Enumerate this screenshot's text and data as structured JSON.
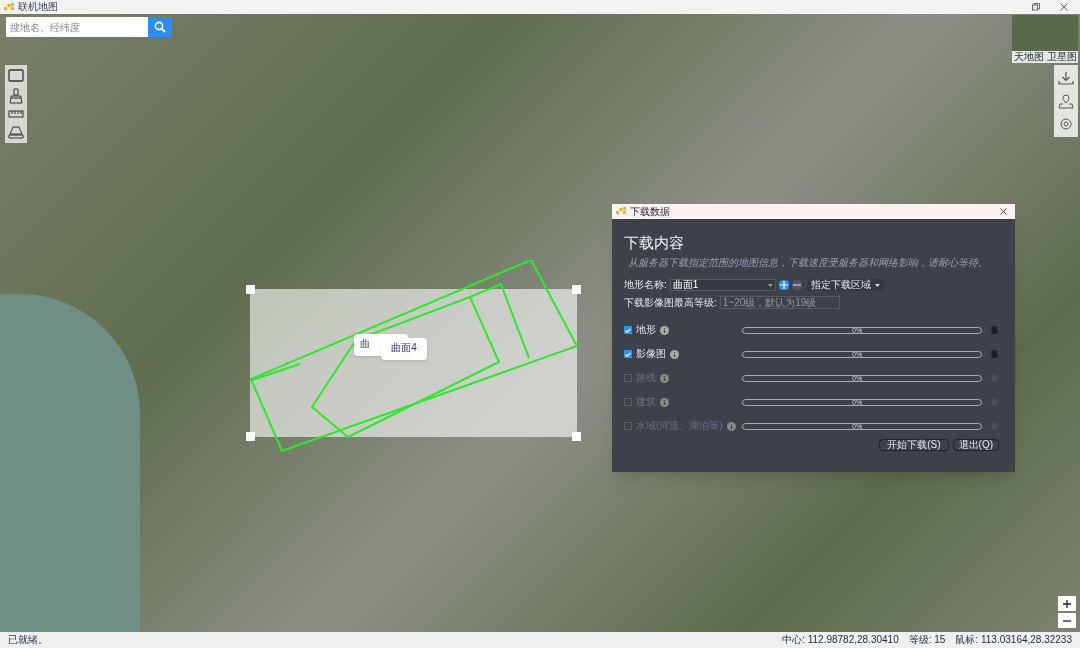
{
  "window": {
    "title": "联机地图"
  },
  "search": {
    "placeholder": "搜地名、经纬度"
  },
  "layer_switcher": {
    "labels": [
      "天地图",
      "卫星图"
    ]
  },
  "map": {
    "popups": [
      {
        "label": "曲"
      },
      {
        "label": "曲面4"
      }
    ]
  },
  "dialog": {
    "title": "下载数据",
    "heading": "下载内容",
    "description": "从服务器下载指定范围的地图信息，下载速度受服务器和网络影响，请耐心等待。",
    "terrain_label": "地形名称:",
    "terrain_value": "曲面1",
    "region_button": "指定下载区域",
    "level_label": "下载影像图最高等级:",
    "level_placeholder": "1~20级，默认为19级",
    "layers": [
      {
        "label": "地形",
        "checked": true,
        "level": 0,
        "reading": "0%"
      },
      {
        "label": "影像图",
        "checked": true,
        "level": 0,
        "reading": "0%"
      },
      {
        "label": "路线",
        "checked": false,
        "level": 0,
        "reading": "0%"
      },
      {
        "label": "建筑",
        "checked": false,
        "level": 0,
        "reading": "0%"
      },
      {
        "label": "水域(河流、湖泊等)",
        "checked": false,
        "level": 0,
        "reading": "0%"
      }
    ],
    "buttons": [
      "开始下载(S)",
      "退出(Q)"
    ]
  },
  "status_bar": {
    "message": "已就绪。",
    "center": "中心: 112.98782,28.30410",
    "level": "等级: 15",
    "mouse": "鼠标: 113.03164,28.32233"
  }
}
